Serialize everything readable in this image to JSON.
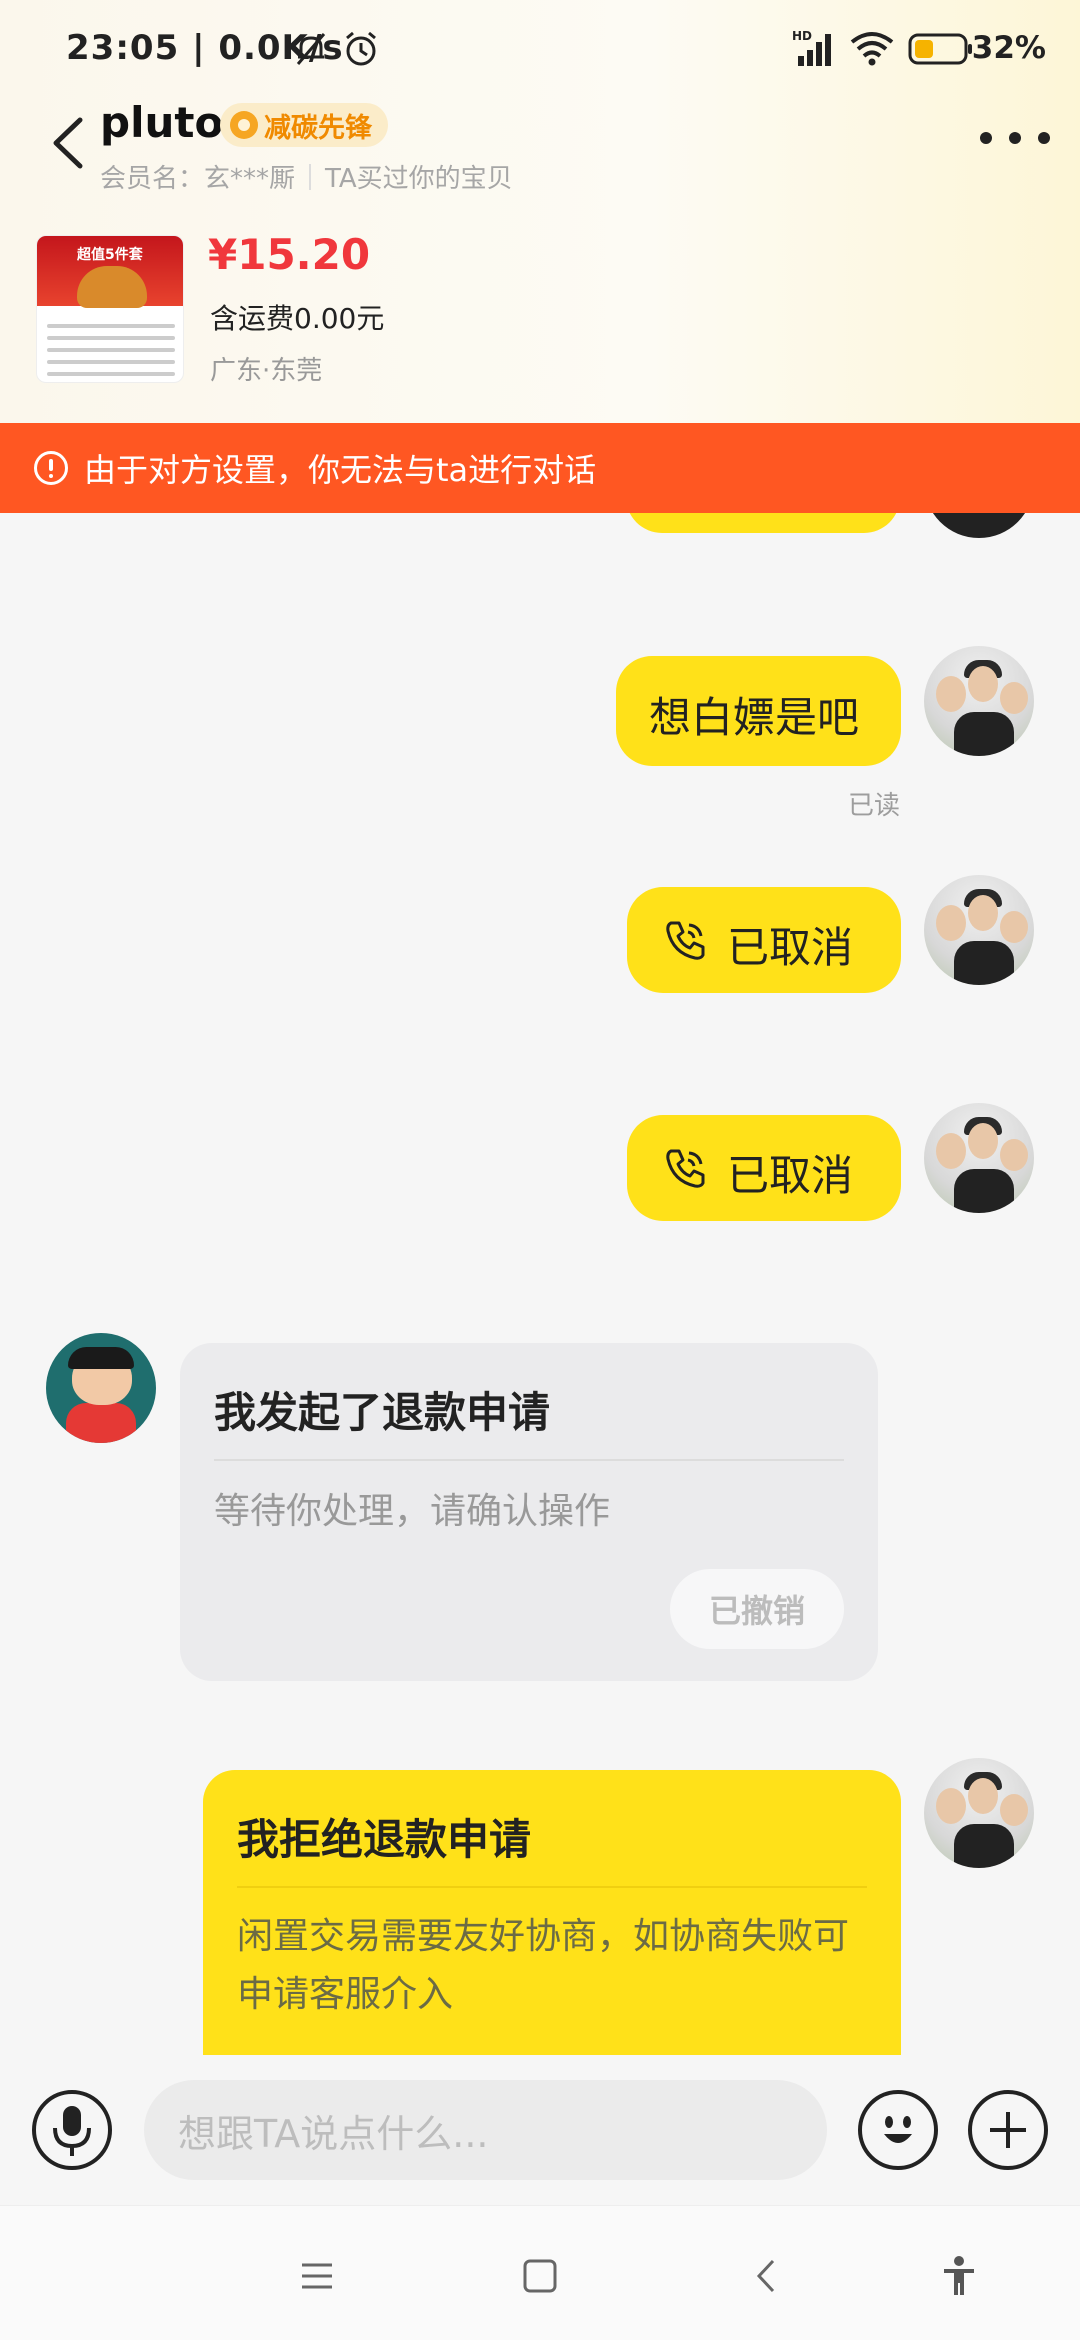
{
  "status_bar": {
    "time": "23:05 | 0.0K/s",
    "battery": "32%"
  },
  "header": {
    "title": "pluto",
    "badge": "减碳先锋",
    "member_label": "会员名：玄***厮",
    "relation": "TA买过你的宝贝"
  },
  "product": {
    "image_title": "超值5件套",
    "price": "¥15.20",
    "shipping": "含运费0.00元",
    "location": "广东·东莞"
  },
  "banner": {
    "text": "由于对方设置，你无法与ta进行对话"
  },
  "messages": {
    "text_msg": "想白嫖是吧",
    "read_status": "已读",
    "call1": "已取消",
    "call2": "已取消"
  },
  "refund_request": {
    "title": "我发起了退款申请",
    "desc": "等待你处理，请确认操作",
    "status_button": "已撤销"
  },
  "refund_reject": {
    "title": "我拒绝退款申请",
    "desc": "闲置交易需要友好协商，如协商失败可申请客服介入"
  },
  "input": {
    "placeholder": "想跟TA说点什么..."
  },
  "icons": {
    "voice": "microphone-icon",
    "emoji": "emoji-icon",
    "add": "plus-icon",
    "call": "phone-icon"
  },
  "colors": {
    "accent_yellow": "#ffe119",
    "banner_orange": "#ff5722",
    "price_red": "#f0373c"
  }
}
